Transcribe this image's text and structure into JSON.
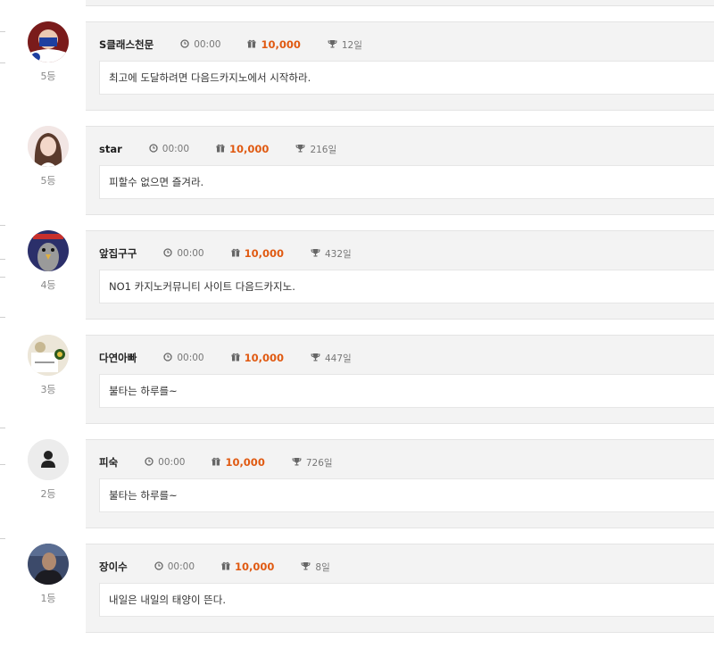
{
  "comments": [
    {
      "name": "S클래스천문",
      "time": "00:00",
      "points": "10,000",
      "days": "12일",
      "rank": "5등",
      "message": "최고에 도달하려면 다음드카지노에서 시작하라.",
      "avatar": "flag-avatar"
    },
    {
      "name": "star",
      "time": "00:00",
      "points": "10,000",
      "days": "216일",
      "rank": "5등",
      "message": "피할수 없으면 즐겨라.",
      "avatar": "photo-avatar"
    },
    {
      "name": "앞집구구",
      "time": "00:00",
      "points": "10,000",
      "days": "432일",
      "rank": "4등",
      "message": "NO1 카지노커뮤니티 사이트 다음드카지노.",
      "avatar": "bird-avatar"
    },
    {
      "name": "다연아빠",
      "time": "00:00",
      "points": "10,000",
      "days": "447일",
      "rank": "3등",
      "message": "불타는 하루를~",
      "avatar": "photo-avatar"
    },
    {
      "name": "피숙",
      "time": "00:00",
      "points": "10,000",
      "days": "726일",
      "rank": "2등",
      "message": "불타는 하루를~",
      "avatar": "default-user-icon"
    },
    {
      "name": "장이수",
      "time": "00:00",
      "points": "10,000",
      "days": "8일",
      "rank": "1등",
      "message": "내일은 내일의 태양이 뜬다.",
      "avatar": "photo-avatar"
    }
  ],
  "colors": {
    "points": "#e05a12",
    "card_bg": "#f3f3f3",
    "rank": "#888888"
  }
}
